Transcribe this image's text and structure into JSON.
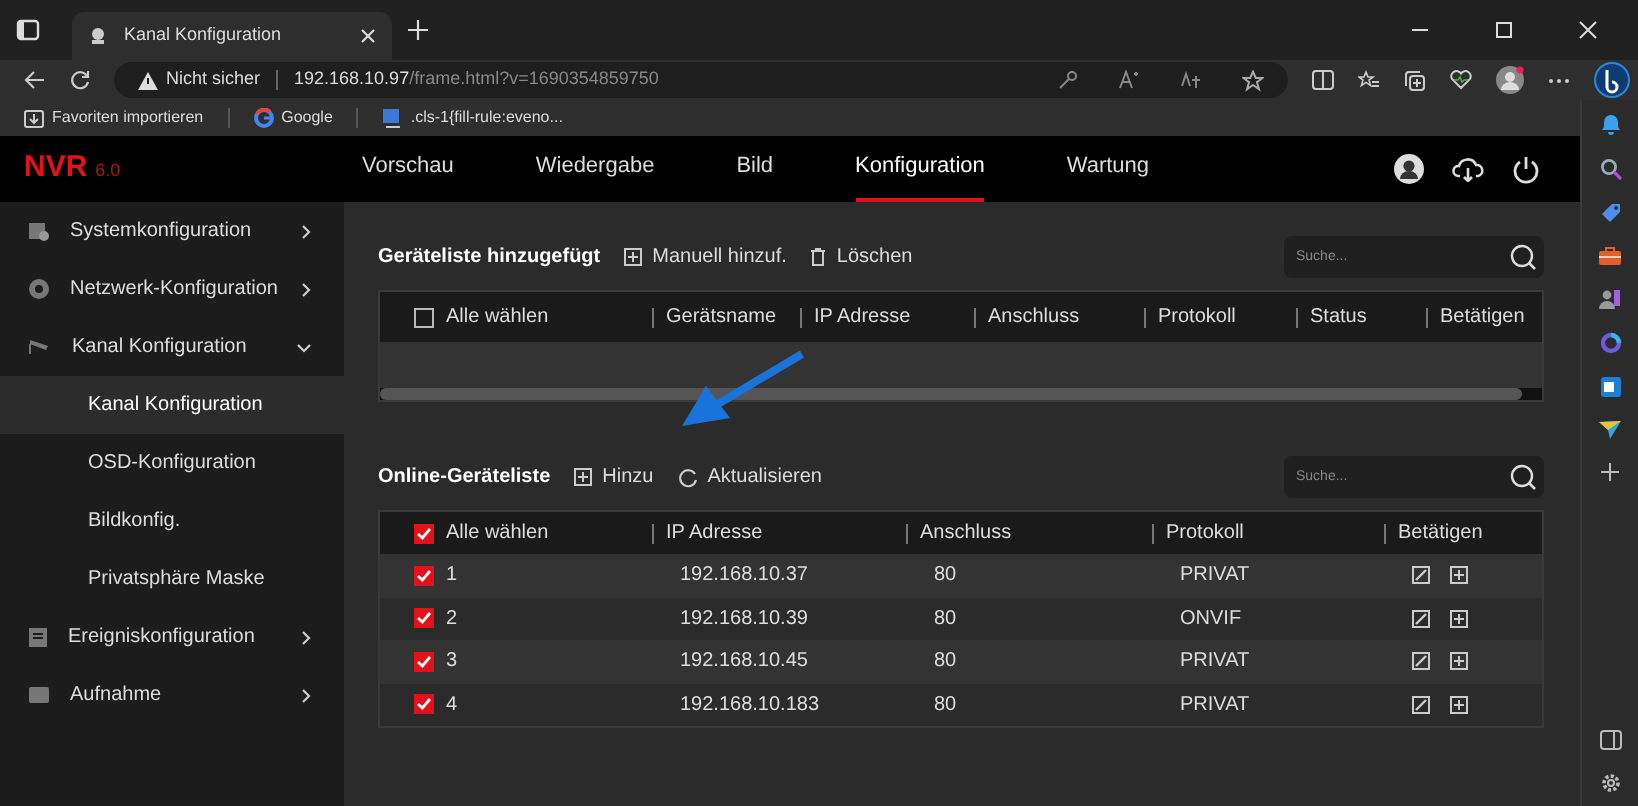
{
  "browser": {
    "tab_title": "Kanal Konfiguration",
    "security": "Nicht sicher",
    "host": "192.168.10.97",
    "path": "/frame.html?v=1690354859750",
    "bookmarks": [
      {
        "kind": "import",
        "label": "Favoriten importieren"
      },
      {
        "kind": "google",
        "label": "Google"
      },
      {
        "kind": "page",
        "label": ".cls-1{fill-rule:eveno..."
      }
    ]
  },
  "app": {
    "logo": "NVR",
    "version": "6.0",
    "nav": [
      {
        "label": "Vorschau",
        "selected": false
      },
      {
        "label": "Wiedergabe",
        "selected": false
      },
      {
        "label": "Bild",
        "selected": false
      },
      {
        "label": "Konfiguration",
        "selected": true
      },
      {
        "label": "Wartung",
        "selected": false
      }
    ],
    "sidebar": [
      {
        "label": "Systemkonfiguration",
        "expanded": false
      },
      {
        "label": "Netzwerk-Konfiguration",
        "expanded": false
      },
      {
        "label": "Kanal Konfiguration",
        "expanded": true,
        "children": [
          {
            "label": "Kanal Konfiguration",
            "selected": true
          },
          {
            "label": "OSD-Konfiguration",
            "selected": false
          },
          {
            "label": "Bildkonfig.",
            "selected": false
          },
          {
            "label": "Privatsphäre Maske",
            "selected": false
          }
        ]
      },
      {
        "label": "Ereigniskonfiguration",
        "expanded": false
      },
      {
        "label": "Aufnahme",
        "expanded": false
      }
    ]
  },
  "added_devices": {
    "title": "Geräteliste hinzugefügt",
    "actions": [
      {
        "kind": "add",
        "label": "Manuell hinzuf."
      },
      {
        "kind": "delete",
        "label": "Löschen"
      }
    ],
    "search": {
      "placeholder": "Suche..."
    },
    "select_all": {
      "label": "Alle wählen",
      "checked": false
    },
    "columns": [
      "Gerätsname",
      "IP Adresse",
      "Anschluss",
      "Protokoll",
      "Status",
      "Betätigen"
    ]
  },
  "online_devices": {
    "title": "Online-Geräteliste",
    "actions": [
      {
        "kind": "add",
        "label": "Hinzu"
      },
      {
        "kind": "refresh",
        "label": "Aktualisieren"
      }
    ],
    "search": {
      "placeholder": "Suche..."
    },
    "select_all": {
      "label": "Alle wählen",
      "checked": true
    },
    "columns": [
      "IP Adresse",
      "Anschluss",
      "Protokoll",
      "Betätigen"
    ],
    "rows": [
      {
        "checked": true,
        "number": "1",
        "ip": "192.168.10.37",
        "port": "80",
        "protocol": "PRIVAT"
      },
      {
        "checked": true,
        "number": "2",
        "ip": "192.168.10.39",
        "port": "80",
        "protocol": "ONVIF"
      },
      {
        "checked": true,
        "number": "3",
        "ip": "192.168.10.45",
        "port": "80",
        "protocol": "PRIVAT"
      },
      {
        "checked": true,
        "number": "4",
        "ip": "192.168.10.183",
        "port": "80",
        "protocol": "PRIVAT"
      }
    ]
  }
}
